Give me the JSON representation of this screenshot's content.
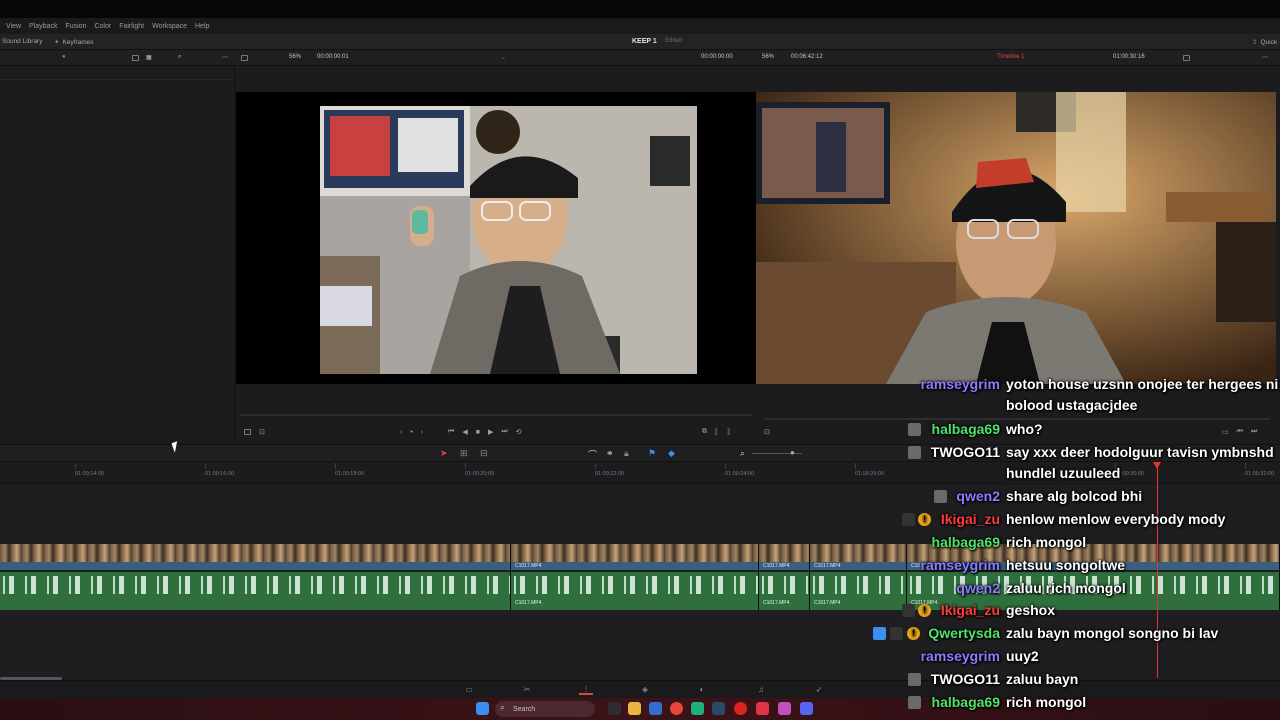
{
  "menu": [
    "View",
    "Playback",
    "Fusion",
    "Color",
    "Fairlight",
    "Workspace",
    "Help"
  ],
  "toolbar1": {
    "sound_library": "Sound Library",
    "keyframes": "Keyframes",
    "project_title": "KEEP 1",
    "project_status": "Edited",
    "quick_export": "Quick"
  },
  "source_viewer": {
    "zoom": "56%",
    "timecode_left": "00:00:00:01",
    "timecode_right": "00:00:00:00"
  },
  "program_viewer": {
    "zoom": "56%",
    "duration": "00:06:42:12",
    "timeline_name": "Timeline 1",
    "timecode": "01:00:30:16"
  },
  "ruler": [
    "01:00:14:00",
    "01:00:16:00",
    "01:00:18:00",
    "01:00:20:00",
    "01:00:22:00",
    "01:00:24:00",
    "01:00:26:00",
    "01:00:30:00",
    "01:00:32:00"
  ],
  "clips": {
    "video": [
      {
        "label": ""
      },
      {
        "label": "C1017.MP4"
      },
      {
        "label": "C1017.MP4"
      },
      {
        "label": "C1017.MP4"
      },
      {
        "label": "C1017.MP4"
      }
    ],
    "audio": [
      {
        "label": ""
      },
      {
        "label": "C1017.MP4"
      },
      {
        "label": "C1017.MP4"
      },
      {
        "label": "C1017.MP4"
      },
      {
        "label": "C1017.MP4"
      }
    ]
  },
  "taskbar": {
    "search_label": "Search"
  },
  "chat": [
    {
      "user": "ramseygrim",
      "color": "#8a7dff",
      "message": "yoton house uzsnn onojee ter hergees ni"
    },
    {
      "user": "",
      "color": "#ffffff",
      "message": "bolood ustagacjdee"
    },
    {
      "user": "halbaga69",
      "color": "#4fe36a",
      "message": "who?"
    },
    {
      "user": "TWOGO11",
      "color": "#ffffff",
      "message": "say xxx deer hodolguur tavisn ymbnshd"
    },
    {
      "user": "",
      "color": "#ffffff",
      "message": "hundlel uzuuleed"
    },
    {
      "user": "qwen2",
      "color": "#8a7dff",
      "message": "share alg bolcod bhi"
    },
    {
      "user": "Ikigai_zu",
      "color": "#ff3b3b",
      "message": "henlow menlow everybody mody"
    },
    {
      "user": "halbaga69",
      "color": "#4fe36a",
      "message": "rich mongol"
    },
    {
      "user": "ramseygrim",
      "color": "#8a7dff",
      "message": "hetsuu songoltwe"
    },
    {
      "user": "qwen2",
      "color": "#8a7dff",
      "message": "zaluu rich mongol"
    },
    {
      "user": "Ikigai_zu",
      "color": "#ff3b3b",
      "message": "geshox"
    },
    {
      "user": "Qwertysda",
      "color": "#4fe36a",
      "message": "zalu bayn mongol songno bi lav"
    },
    {
      "user": "ramseygrim",
      "color": "#8a7dff",
      "message": "uuy2"
    },
    {
      "user": "TWOGO11",
      "color": "#ffffff",
      "message": "zaluu bayn"
    },
    {
      "user": "halbaga69",
      "color": "#4fe36a",
      "message": "rich mongol"
    }
  ]
}
